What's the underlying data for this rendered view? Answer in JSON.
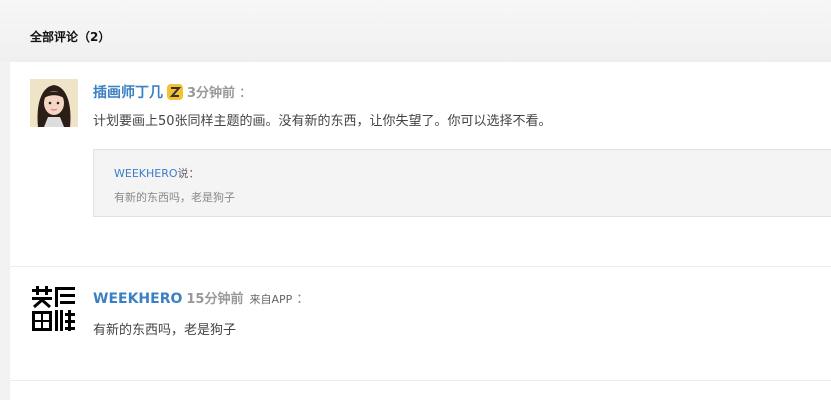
{
  "header": {
    "title": "全部评论（2）"
  },
  "comments": [
    {
      "username": "插画师丁几",
      "has_badge": true,
      "badge_icon": "z-badge-icon",
      "time": "3分钟前",
      "colon": "：",
      "text": "计划要画上50张同样主题的画。没有新的东西，让你失望了。你可以选择不看。",
      "quote": {
        "user": "WEEKHERO",
        "said": "说：",
        "text": "有新的东西吗，老是狗子"
      }
    },
    {
      "username": "WEEKHERO",
      "time": "15分钟前",
      "source": "来自APP",
      "colon": "：",
      "text": "有新的东西吗，老是狗子",
      "avatar_icon": "weekhero-logo-icon"
    }
  ],
  "colors": {
    "link": "#3b7fc4",
    "badge": "#f2c230"
  }
}
